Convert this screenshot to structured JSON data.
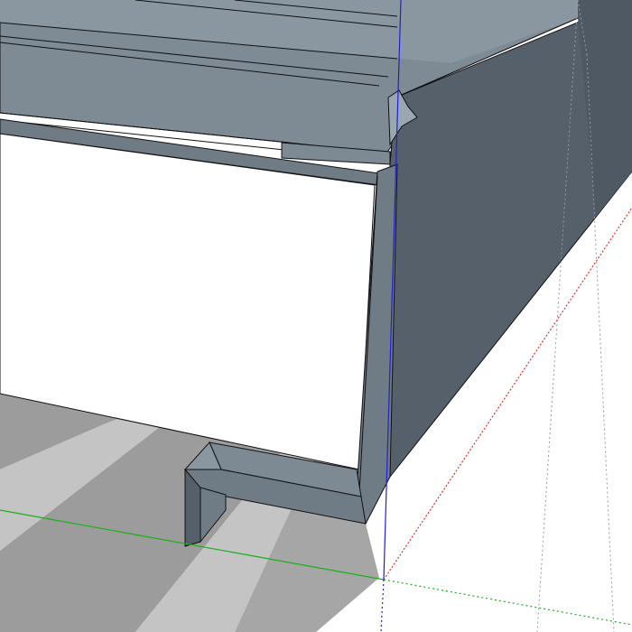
{
  "viewport": {
    "background": "#ffffff"
  },
  "colors": {
    "shadow_dark": "#9c9c9c",
    "shadow_light": "#c4c4c4",
    "top_face": "#7e8a94",
    "top_face_light": "#8a97a1",
    "front_face": "#55606a",
    "front_face_deep": "#4f5963",
    "profile_face": "#6f7b85",
    "profile_face_light": "#7d8993",
    "edge": "#111111",
    "axis_red": "#e03030",
    "axis_green": "#18b018",
    "axis_blue": "#2020d0",
    "guide_gray": "#9a9a9a"
  },
  "axes": {
    "red": {
      "name": "red-axis"
    },
    "green": {
      "name": "green-axis"
    },
    "blue": {
      "name": "blue-axis"
    }
  },
  "model": {
    "object": "z-profile-flashing-corner",
    "visible_labels": []
  }
}
